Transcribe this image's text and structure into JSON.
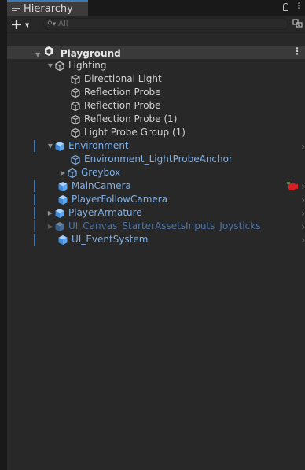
{
  "tab": {
    "title": "Hierarchy",
    "icon": "hierarchy-list-icon"
  },
  "toolbar": {
    "add_label": "+",
    "search": {
      "placeholder": "All",
      "value": ""
    }
  },
  "scene": {
    "name": "Playground",
    "icon": "unity-scene-icon"
  },
  "items": [
    {
      "label": "Lighting",
      "icon": "gameobject-outline-icon"
    },
    {
      "label": "Directional Light",
      "icon": "gameobject-outline-icon"
    },
    {
      "label": "Reflection Probe",
      "icon": "gameobject-outline-icon"
    },
    {
      "label": "Reflection Probe",
      "icon": "gameobject-outline-icon"
    },
    {
      "label": "Reflection Probe (1)",
      "icon": "gameobject-outline-icon"
    },
    {
      "label": "Light Probe Group (1)",
      "icon": "gameobject-outline-icon"
    },
    {
      "label": "Environment",
      "icon": "prefab-cube-icon"
    },
    {
      "label": "Environment_LightProbeAnchor",
      "icon": "gameobject-outline-icon"
    },
    {
      "label": "Greybox",
      "icon": "gameobject-outline-icon"
    },
    {
      "label": "MainCamera",
      "icon": "prefab-cube-icon"
    },
    {
      "label": "PlayerFollowCamera",
      "icon": "prefab-cube-icon"
    },
    {
      "label": "PlayerArmature",
      "icon": "prefab-cube-icon"
    },
    {
      "label": "UI_Canvas_StarterAssetsInputs_Joysticks",
      "icon": "prefab-cube-icon"
    },
    {
      "label": "UI_EventSystem",
      "icon": "prefab-cube-icon"
    }
  ],
  "colors": {
    "panel_bg": "#282828",
    "selected_row": "#3a3a3a",
    "prefab_text": "#7fb0e8",
    "inactive_prefab_text": "#4f73a3",
    "accent": "#3a79bb"
  }
}
